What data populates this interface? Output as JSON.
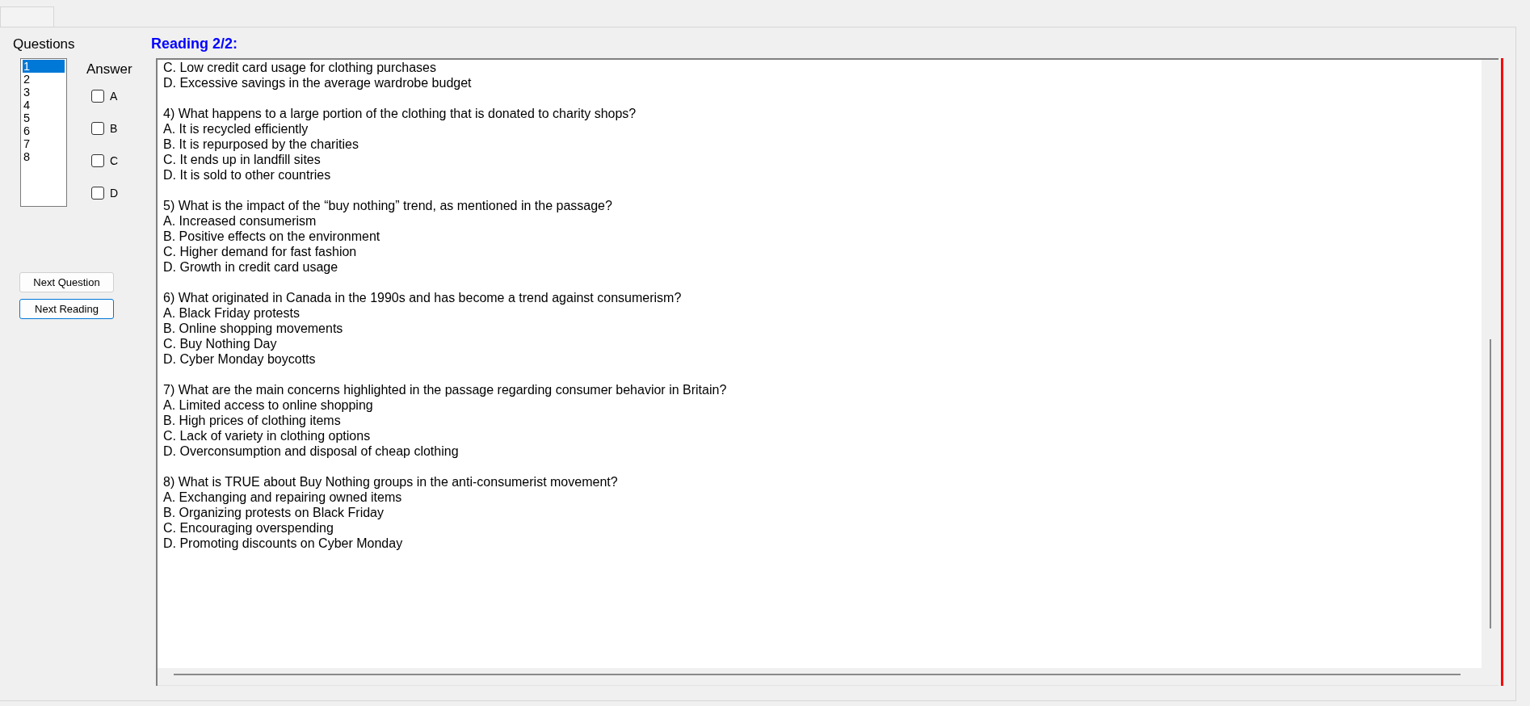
{
  "questions_panel": {
    "label": "Questions",
    "items": [
      {
        "label": "1",
        "selected": true
      },
      {
        "label": "2",
        "selected": false
      },
      {
        "label": "3",
        "selected": false
      },
      {
        "label": "4",
        "selected": false
      },
      {
        "label": "5",
        "selected": false
      },
      {
        "label": "6",
        "selected": false
      },
      {
        "label": "7",
        "selected": false
      },
      {
        "label": "8",
        "selected": false
      }
    ]
  },
  "answer_panel": {
    "label": "Answer",
    "options": [
      {
        "label": "A",
        "checked": false
      },
      {
        "label": "B",
        "checked": false
      },
      {
        "label": "C",
        "checked": false
      },
      {
        "label": "D",
        "checked": false
      }
    ]
  },
  "buttons": [
    {
      "label": "Next Question",
      "focused": false
    },
    {
      "label": "Next Reading",
      "focused": true
    }
  ],
  "reading": {
    "title": "Reading 2/2:",
    "questions": [
      {
        "options": [
          "C. Low credit card usage for clothing purchases",
          "D. Excessive savings in the average wardrobe budget"
        ]
      },
      {
        "question": "4) What happens to a large portion of the clothing that is donated to charity shops?",
        "options": [
          "A. It is recycled efficiently",
          "B. It is repurposed by the charities",
          "C. It ends up in landfill sites",
          "D. It is sold to other countries"
        ]
      },
      {
        "question": "5) What is the impact of the “buy nothing” trend, as mentioned in the passage?",
        "options": [
          "A. Increased consumerism",
          "B. Positive effects on the environment",
          "C. Higher demand for fast fashion",
          "D. Growth in credit card usage"
        ]
      },
      {
        "question": "6) What originated in Canada in the 1990s and has become a trend against consumerism?",
        "options": [
          "A. Black Friday protests",
          "B. Online shopping movements",
          "C. Buy Nothing Day",
          "D. Cyber Monday boycotts"
        ]
      },
      {
        "question": "7) What are the main concerns highlighted in the passage regarding consumer behavior in Britain?",
        "options": [
          "A. Limited access to online shopping",
          "B. High prices of clothing items",
          "C. Lack of variety in clothing options",
          "D. Overconsumption and disposal of cheap clothing"
        ]
      },
      {
        "question": "8) What is TRUE about Buy Nothing groups in the anti-consumerist movement?",
        "options": [
          "A. Exchanging and repairing owned items",
          "B. Organizing protests on Black Friday",
          "C. Encouraging overspending",
          "D. Promoting discounts on Cyber Monday"
        ]
      }
    ]
  }
}
